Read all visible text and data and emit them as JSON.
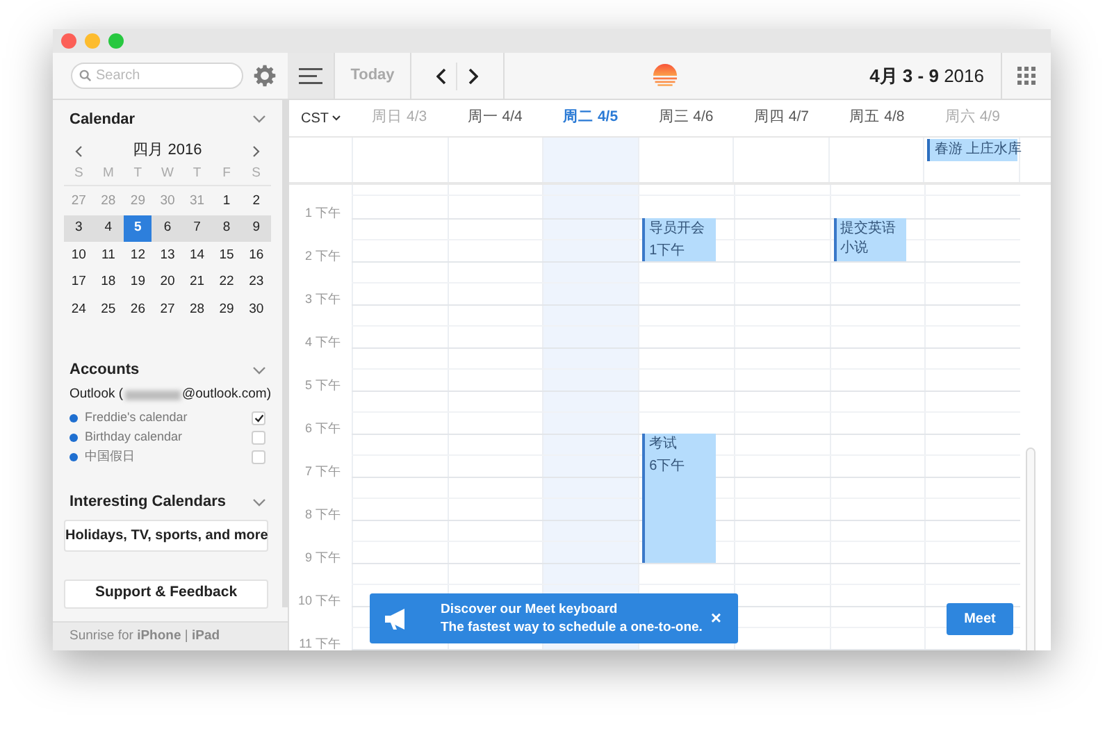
{
  "toolbar": {
    "search": {
      "placeholder": "Search"
    },
    "today": "Today",
    "date_range": "**4月 3 - 9** 2016"
  },
  "sidebar": {
    "calendar": {
      "title": "Calendar",
      "month": "四月 2016",
      "weekdays": [
        "S",
        "M",
        "T",
        "W",
        "T",
        "F",
        "S"
      ],
      "weeks": [
        {
          "highlighted": false,
          "days": [
            {
              "label": "27",
              "in_month": false,
              "selected": false
            },
            {
              "label": "28",
              "in_month": false,
              "selected": false
            },
            {
              "label": "29",
              "in_month": false,
              "selected": false
            },
            {
              "label": "30",
              "in_month": false,
              "selected": false
            },
            {
              "label": "31",
              "in_month": false,
              "selected": false
            },
            {
              "label": "1",
              "in_month": true,
              "selected": false
            },
            {
              "label": "2",
              "in_month": true,
              "selected": false
            }
          ]
        },
        {
          "highlighted": true,
          "days": [
            {
              "label": "3",
              "in_month": true,
              "selected": false
            },
            {
              "label": "4",
              "in_month": true,
              "selected": false
            },
            {
              "label": "5",
              "in_month": true,
              "selected": true
            },
            {
              "label": "6",
              "in_month": true,
              "selected": false
            },
            {
              "label": "7",
              "in_month": true,
              "selected": false
            },
            {
              "label": "8",
              "in_month": true,
              "selected": false
            },
            {
              "label": "9",
              "in_month": true,
              "selected": false
            }
          ]
        },
        {
          "highlighted": false,
          "days": [
            {
              "label": "10",
              "in_month": true,
              "selected": false
            },
            {
              "label": "11",
              "in_month": true,
              "selected": false
            },
            {
              "label": "12",
              "in_month": true,
              "selected": false
            },
            {
              "label": "13",
              "in_month": true,
              "selected": false
            },
            {
              "label": "14",
              "in_month": true,
              "selected": false
            },
            {
              "label": "15",
              "in_month": true,
              "selected": false
            },
            {
              "label": "16",
              "in_month": true,
              "selected": false
            }
          ]
        },
        {
          "highlighted": false,
          "days": [
            {
              "label": "17",
              "in_month": true,
              "selected": false
            },
            {
              "label": "18",
              "in_month": true,
              "selected": false
            },
            {
              "label": "19",
              "in_month": true,
              "selected": false
            },
            {
              "label": "20",
              "in_month": true,
              "selected": false
            },
            {
              "label": "21",
              "in_month": true,
              "selected": false
            },
            {
              "label": "22",
              "in_month": true,
              "selected": false
            },
            {
              "label": "23",
              "in_month": true,
              "selected": false
            }
          ]
        },
        {
          "highlighted": false,
          "days": [
            {
              "label": "24",
              "in_month": true,
              "selected": false
            },
            {
              "label": "25",
              "in_month": true,
              "selected": false
            },
            {
              "label": "26",
              "in_month": true,
              "selected": false
            },
            {
              "label": "27",
              "in_month": true,
              "selected": false
            },
            {
              "label": "28",
              "in_month": true,
              "selected": false
            },
            {
              "label": "29",
              "in_month": true,
              "selected": false
            },
            {
              "label": "30",
              "in_month": true,
              "selected": false
            }
          ]
        }
      ]
    },
    "accounts": {
      "title": "Accounts",
      "account": {
        "prefix": "Outlook (",
        "redacted": true,
        "suffix": "@outlook.com)"
      },
      "calendars": [
        {
          "name": "Freddie's calendar",
          "color": "#1f6fd0",
          "checked": true
        },
        {
          "name": "Birthday calendar",
          "color": "#1f6fd0",
          "checked": false
        },
        {
          "name": "中国假日",
          "color": "#1f6fd0",
          "checked": false
        }
      ]
    },
    "interesting": {
      "title": "Interesting Calendars",
      "button": "Holidays, TV, sports, and more"
    },
    "support_button": "Support & Feedback",
    "footer": "Sunrise for **iPhone** | **iPad**"
  },
  "week": {
    "timezone": "CST",
    "days": [
      {
        "label": "周日 4/3",
        "selected": false,
        "weekend": true
      },
      {
        "label": "周一 4/4",
        "selected": false,
        "weekend": false
      },
      {
        "label": "周二 4/5",
        "selected": true,
        "weekend": false
      },
      {
        "label": "周三 4/6",
        "selected": false,
        "weekend": false,
        "slots": [
          {
            "kind": "event",
            "title": "导员开会",
            "time": "1下午"
          },
          {
            "kind": "free"
          },
          {
            "kind": "free"
          },
          {
            "kind": "free"
          },
          {
            "kind": "free"
          },
          {
            "kind": "event",
            "title": "考试",
            "time": "6下午"
          },
          {
            "kind": "continued"
          },
          {
            "kind": "continued"
          }
        ]
      },
      {
        "label": "周四 4/7",
        "selected": false,
        "weekend": false
      },
      {
        "label": "周五 4/8",
        "selected": false,
        "weekend": false,
        "slots": [
          {
            "kind": "event",
            "title": "提交英语小说"
          }
        ]
      },
      {
        "label": "周六 4/9",
        "selected": false,
        "weekend": true,
        "all_day": [
          {
            "title": "春游 上庄水库"
          }
        ]
      }
    ],
    "hours": [
      "1 下午",
      "2 下午",
      "3 下午",
      "4 下午",
      "5 下午",
      "6 下午",
      "7 下午",
      "8 下午",
      "9 下午",
      "10 下午",
      "11 下午"
    ]
  },
  "banner": {
    "title": "Discover our Meet keyboard",
    "subtitle": "The fastest way to schedule a one-to-one.",
    "close": "×"
  },
  "meet_button": "Meet"
}
